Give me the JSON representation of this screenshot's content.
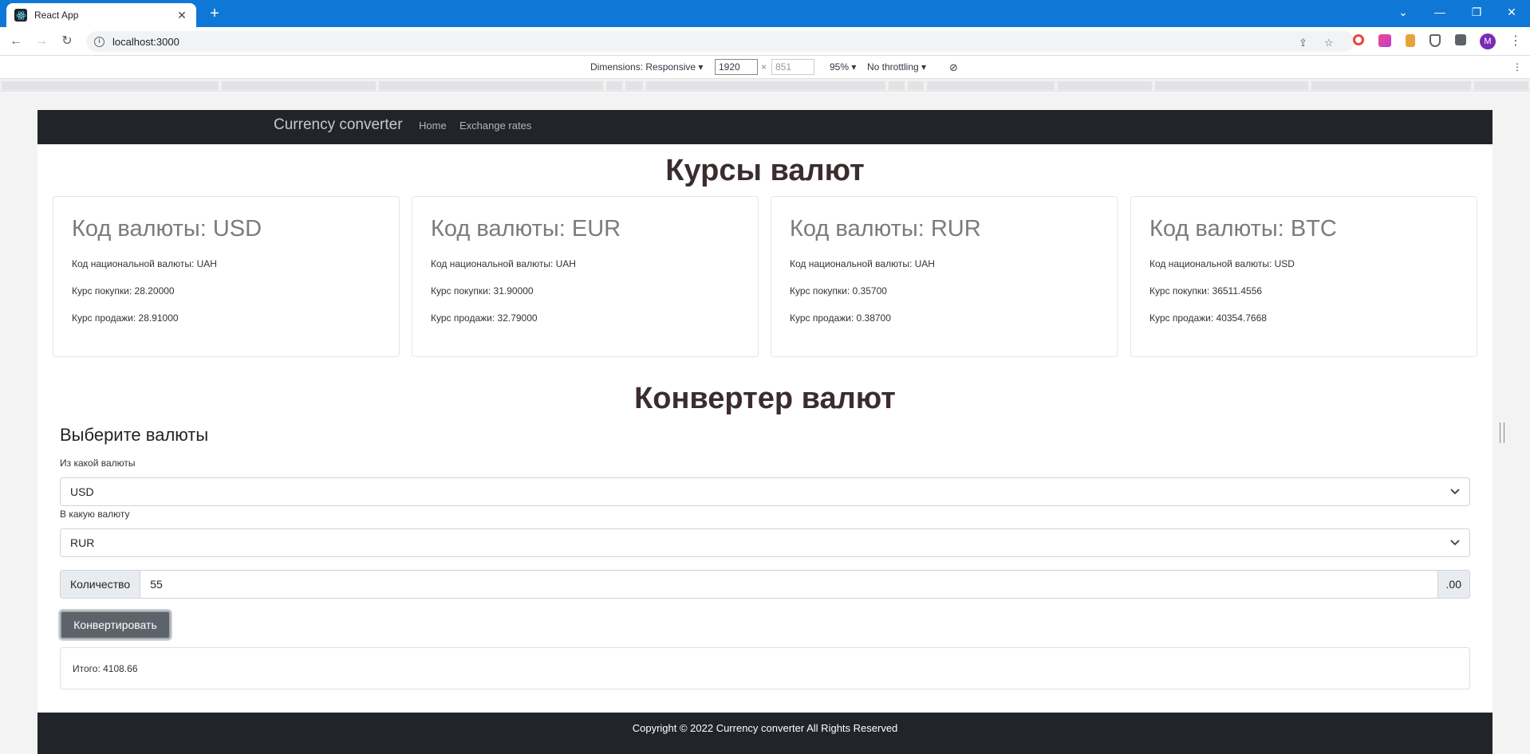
{
  "browser": {
    "tab_title": "React App",
    "url": "localhost:3000",
    "avatar_letter": "M"
  },
  "devtools": {
    "dimensions_label": "Dimensions: Responsive",
    "width": "1920",
    "height_placeholder": "851",
    "times": "×",
    "zoom": "95%",
    "throttling": "No throttling"
  },
  "navbar": {
    "brand": "Currency converter",
    "links": [
      "Home",
      "Exchange rates"
    ]
  },
  "rates": {
    "heading": "Курсы валют",
    "cards": [
      {
        "title": "Код валюты: USD",
        "national": "Код национальной валюты: UAH",
        "buy": "Курс покупки: 28.20000",
        "sell": "Курс продажи: 28.91000"
      },
      {
        "title": "Код валюты: EUR",
        "national": "Код национальной валюты: UAH",
        "buy": "Курс покупки: 31.90000",
        "sell": "Курс продажи: 32.79000"
      },
      {
        "title": "Код валюты: RUR",
        "national": "Код национальной валюты: UAH",
        "buy": "Курс покупки: 0.35700",
        "sell": "Курс продажи: 0.38700"
      },
      {
        "title": "Код валюты: BTC",
        "national": "Код национальной валюты: USD",
        "buy": "Курс покупки: 36511.4556",
        "sell": "Курс продажи: 40354.7668"
      }
    ]
  },
  "converter": {
    "heading": "Конвертер валют",
    "subtitle": "Выберите валюты",
    "from_label": "Из какой валюты",
    "from_value": "USD",
    "to_label": "В какую валюту",
    "to_value": "RUR",
    "qty_label": "Количество",
    "qty_value": "55",
    "qty_suffix": ".00",
    "button": "Конвертировать",
    "result": "Итого: 4108.66"
  },
  "footer": {
    "text": "Copyright © 2022 Currency converter All Rights Reserved"
  }
}
